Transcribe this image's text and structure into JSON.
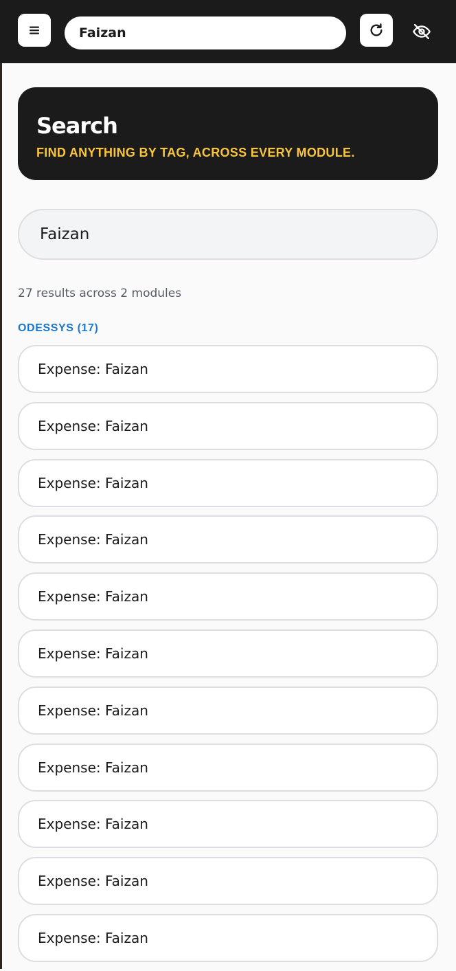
{
  "header": {
    "menu_icon": "hamburger-menu-icon",
    "search_value": "Faizan",
    "refresh_icon": "refresh-icon",
    "visibility_icon": "eye-off-icon"
  },
  "hero": {
    "title": "Search",
    "subtitle": "FIND ANYTHING BY TAG, ACROSS EVERY MODULE."
  },
  "search": {
    "value": "Faizan"
  },
  "results": {
    "summary": "27 results across 2 modules",
    "modules": [
      {
        "heading": "ODESSYS (17)",
        "items": [
          "Expense: Faizan",
          "Expense: Faizan",
          "Expense: Faizan",
          "Expense: Faizan",
          "Expense: Faizan",
          "Expense: Faizan",
          "Expense: Faizan",
          "Expense: Faizan",
          "Expense: Faizan",
          "Expense: Faizan",
          "Expense: Faizan"
        ]
      }
    ]
  },
  "colors": {
    "dark": "#1b1b1b",
    "accent_yellow": "#f8c53d",
    "accent_blue": "#1a78cf",
    "card_border": "#dcdee2",
    "background": "#fafafa"
  }
}
